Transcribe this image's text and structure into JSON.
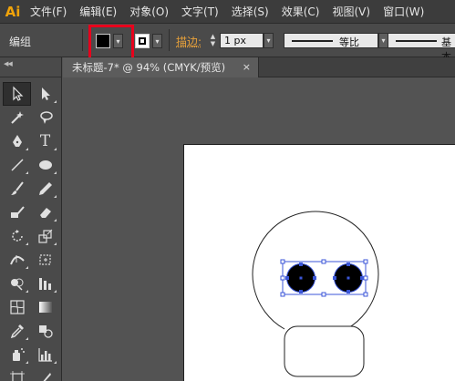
{
  "app": {
    "logo": "Ai",
    "accent": "#f0a30a"
  },
  "menu": {
    "items": [
      "文件(F)",
      "编辑(E)",
      "对象(O)",
      "文字(T)",
      "选择(S)",
      "效果(C)",
      "视图(V)",
      "窗口(W)"
    ]
  },
  "control_bar": {
    "mode_label": "编组",
    "fill_color": "#000000",
    "stroke_label": "描边:",
    "stroke_weight": "1 px",
    "profile_label": "等比",
    "brush_label": "基本",
    "highlight_color": "#e8001c"
  },
  "document": {
    "tab_label": "未标题-7* @ 94% (CMYK/预览)",
    "close_glyph": "×"
  },
  "tools": [
    {
      "name": "selection-tool",
      "icon": "arrow-icon"
    },
    {
      "name": "direct-selection-tool",
      "icon": "direct-arrow-icon"
    },
    {
      "name": "magic-wand-tool",
      "icon": "magic-wand-icon"
    },
    {
      "name": "lasso-tool",
      "icon": "lasso-icon"
    },
    {
      "name": "pen-tool",
      "icon": "pen-icon"
    },
    {
      "name": "type-tool",
      "icon": "type-icon",
      "glyph": "T"
    },
    {
      "name": "line-tool",
      "icon": "line-icon"
    },
    {
      "name": "ellipse-tool",
      "icon": "ellipse-icon"
    },
    {
      "name": "paintbrush-tool",
      "icon": "brush-icon"
    },
    {
      "name": "pencil-tool",
      "icon": "pencil-icon"
    },
    {
      "name": "blob-brush-tool",
      "icon": "blob-brush-icon"
    },
    {
      "name": "eraser-tool",
      "icon": "eraser-icon"
    },
    {
      "name": "rotate-tool",
      "icon": "rotate-icon"
    },
    {
      "name": "scale-tool",
      "icon": "scale-icon"
    },
    {
      "name": "width-tool",
      "icon": "width-icon"
    },
    {
      "name": "free-transform-tool",
      "icon": "free-transform-icon"
    },
    {
      "name": "shape-builder-tool",
      "icon": "shape-builder-icon"
    },
    {
      "name": "perspective-grid-tool",
      "icon": "perspective-icon"
    },
    {
      "name": "mesh-tool",
      "icon": "mesh-icon"
    },
    {
      "name": "gradient-tool",
      "icon": "gradient-icon"
    },
    {
      "name": "eyedropper-tool",
      "icon": "eyedropper-icon"
    },
    {
      "name": "blend-tool",
      "icon": "blend-icon"
    },
    {
      "name": "symbol-sprayer-tool",
      "icon": "symbol-sprayer-icon"
    },
    {
      "name": "column-graph-tool",
      "icon": "column-graph-icon"
    },
    {
      "name": "artboard-tool",
      "icon": "artboard-icon"
    },
    {
      "name": "slice-tool",
      "icon": "slice-icon"
    }
  ]
}
